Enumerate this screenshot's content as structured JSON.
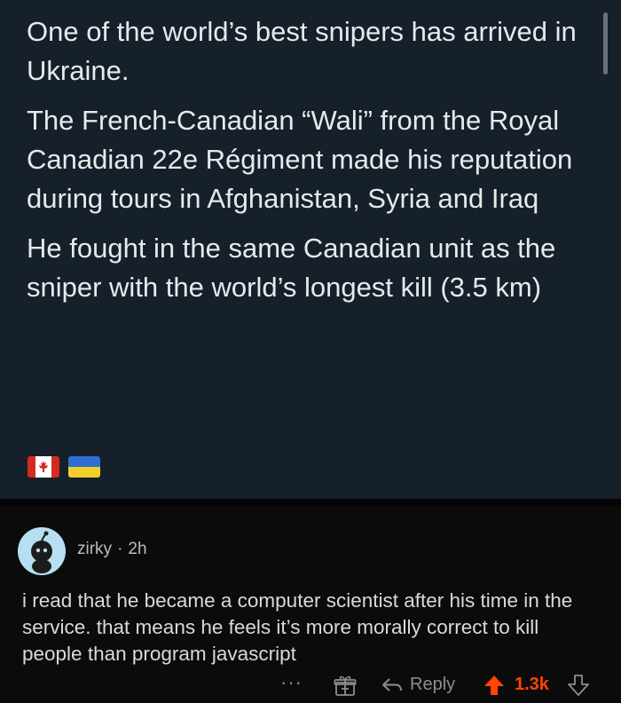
{
  "tweet": {
    "paragraphs": [
      "One of the world’s best snipers has arrived in Ukraine.",
      "The French-Canadian “Wali” from the Royal Canadian 22e Régiment made his reputation during tours in Afghanistan, Syria and Iraq",
      "He fought in the same Canadian unit as the sniper with the world’s longest kill (3.5 km)"
    ],
    "flags": [
      "canada-flag",
      "ukraine-flag"
    ]
  },
  "comment": {
    "username": "zirky",
    "separator": "·",
    "time": "2h",
    "body": "i read that he became a computer scientist after his time in the service. that means he feels it’s more morally correct to kill people than program javascript",
    "actions": {
      "more": "···",
      "reply_label": "Reply",
      "score": "1.3k"
    }
  },
  "colors": {
    "tweet_bg": "#15202b",
    "comment_bg": "#0b0b0c",
    "upvote": "#ff4500",
    "avatar_bg": "#b6e0f2"
  }
}
